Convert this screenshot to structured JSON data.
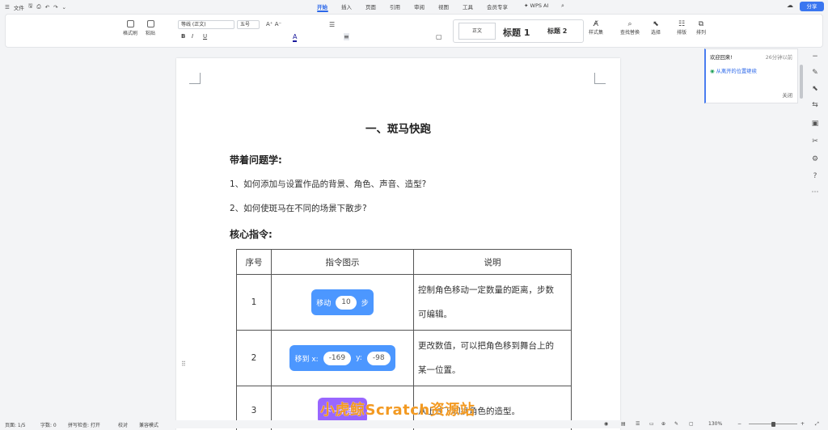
{
  "topbar": {
    "file_label": "文件",
    "tabs": [
      "开始",
      "插入",
      "页面",
      "引用",
      "审阅",
      "视图",
      "工具",
      "会员专享"
    ],
    "active_tab": "开始",
    "wps_ai": "WPS AI",
    "share": "分享"
  },
  "ribbon": {
    "format_painter": "格式刷",
    "paste": "粘贴",
    "font_name": "等线 (正文)",
    "font_size": "五号",
    "style_normal": "正文",
    "style_h1": "标题 1",
    "style_h2": "标题 2",
    "styles_set": "样式集",
    "find_replace": "查找替换",
    "select": "选择",
    "layout": "排版",
    "arrange": "排列"
  },
  "welcome": {
    "title": "欢迎回来!",
    "time": "26分钟以前",
    "resume": "从离开的位置继续",
    "close": "关闭"
  },
  "doc": {
    "title": "一、斑马快跑",
    "section1": "带着问题学:",
    "q1": "1、如何添加与设置作品的背景、角色、声音、造型?",
    "q2": "2、如何使斑马在不同的场景下散步?",
    "section2": "核心指令:",
    "table": {
      "headers": [
        "序号",
        "指令图示",
        "说明"
      ],
      "rows": [
        {
          "num": "1",
          "block_prefix": "移动",
          "block_value": "10",
          "block_suffix": "步",
          "desc_line1": "控制角色移动一定数量的距离，步数",
          "desc_line2": "可编辑。"
        },
        {
          "num": "2",
          "block_prefix": "移到 x:",
          "block_value": "-169",
          "block_mid": "y:",
          "block_value2": "-98",
          "desc_line1": "更改数值，可以把角色移到舞台上的",
          "desc_line2": "某一位置。"
        },
        {
          "num": "3",
          "block_prefix": "下一个造型",
          "desc_line1": "从上往下切换角色的造型。"
        }
      ]
    }
  },
  "status": {
    "page": "页面: 1/5",
    "words": "字数: 0",
    "spell": "拼写检查: 打开",
    "proof": "校对",
    "compat": "兼容模式",
    "zoom": "130%"
  },
  "watermark": "小虎鲸Scratch资源站",
  "colors": {
    "accent": "#2b67e9",
    "motion_block": "#4c97ff",
    "looks_block": "#9966ff",
    "watermark": "#f39a22"
  }
}
